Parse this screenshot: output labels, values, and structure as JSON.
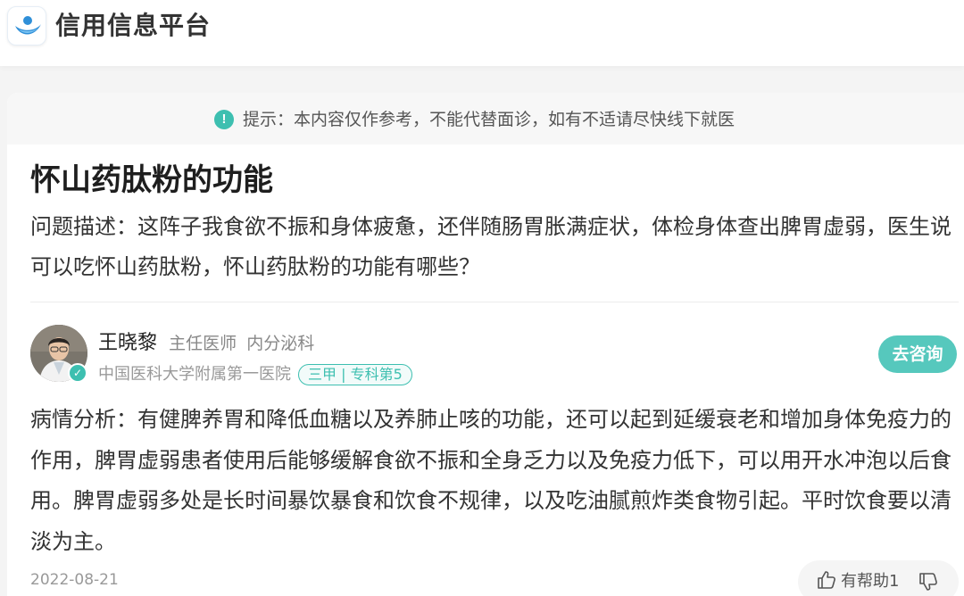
{
  "header": {
    "brand": "信用信息平台",
    "logo_icon": "platform-logo-icon"
  },
  "notice": {
    "icon": "exclamation-icon",
    "text": "提示：本内容仅作参考，不能代替面诊，如有不适请尽快线下就医"
  },
  "question": {
    "title": "怀山药肽粉的功能",
    "description": "问题描述：这阵子我食欲不振和身体疲惫，还伴随肠胃胀满症状，体检身体查出脾胃虚弱，医生说可以吃怀山药肽粉，怀山药肽粉的功能有哪些？"
  },
  "doctor": {
    "name": "王晓黎",
    "title": "主任医师",
    "department": "内分泌科",
    "hospital": "中国医科大学附属第一医院",
    "tag": "三甲 | 专科第5",
    "consult_label": "去咨询"
  },
  "answer": {
    "analysis": "病情分析：有健脾养胃和降低血糖以及养肺止咳的功能，还可以起到延缓衰老和增加身体免疫力的作用，脾胃虚弱患者使用后能够缓解食欲不振和全身乏力以及免疫力低下，可以用开水冲泡以后食用。脾胃虚弱多处是长时间暴饮暴食和饮食不规律，以及吃油腻煎炸类食物引起。平时饮食要以清淡为主。",
    "date": "2022-08-21",
    "helpful_label": "有帮助1"
  },
  "colors": {
    "accent": "#3dbfb0",
    "button": "#56c8bd"
  }
}
